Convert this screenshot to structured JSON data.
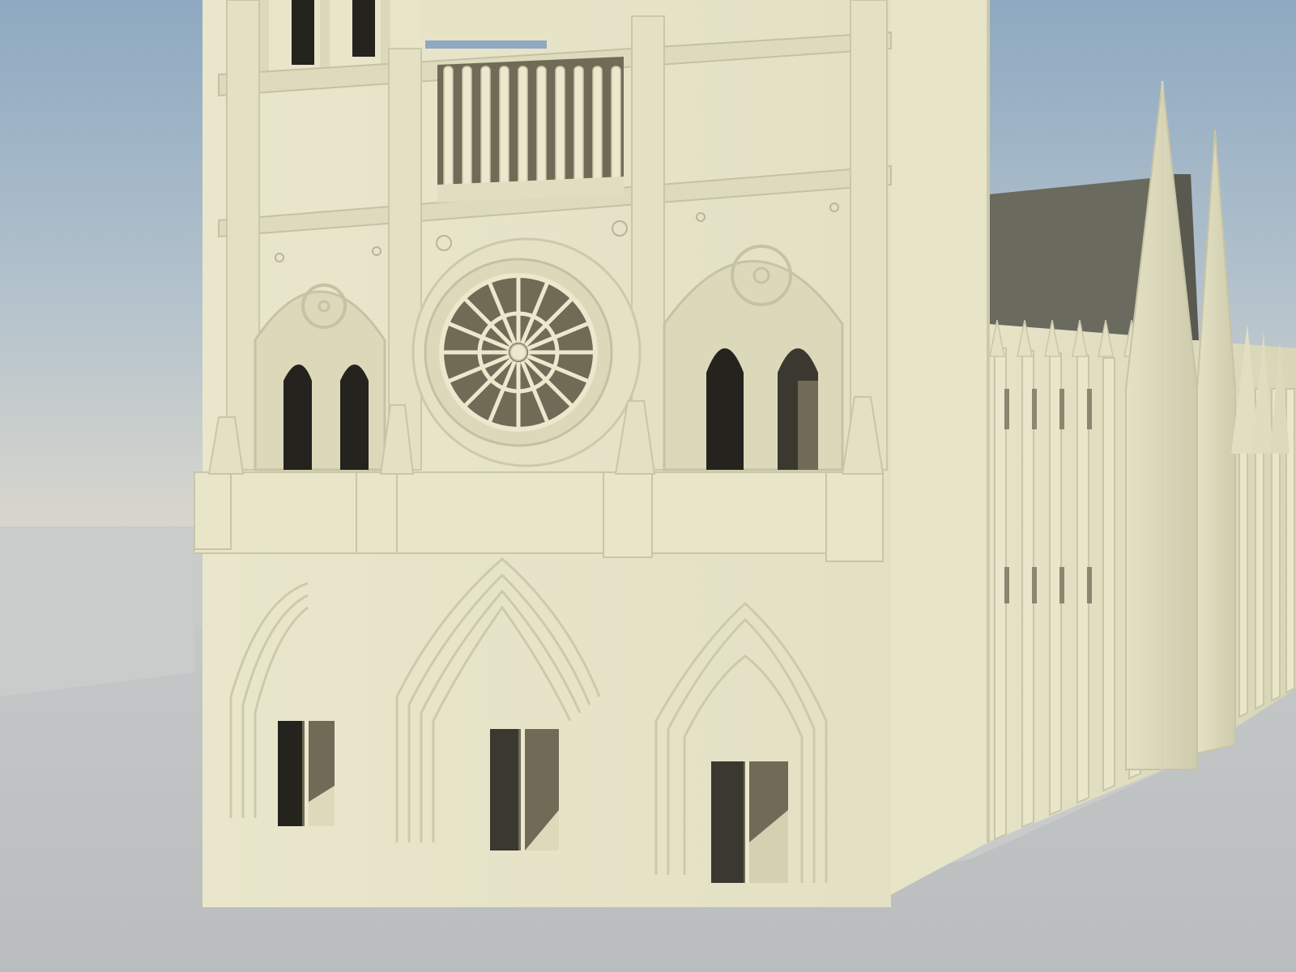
{
  "scene": {
    "subject": "cathedral-render",
    "palette": {
      "sky_top": "#8ea9c1",
      "sky_bottom": "#d9d7cd",
      "ground_far": "#c5c8c8",
      "ground_near": "#bcc0c0",
      "stone_light": "#ebe8cd",
      "stone_mid": "#dcd8ba",
      "stone_shadow": "#b9b49a",
      "roof": "#6b6a5f",
      "opening_dark": "#24231d",
      "opening_mid": "#6f6b57"
    }
  }
}
